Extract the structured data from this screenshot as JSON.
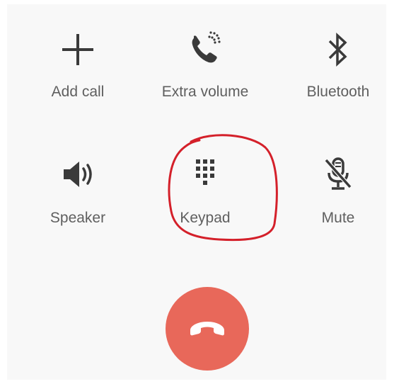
{
  "call_controls": {
    "row1": {
      "add_call": {
        "label": "Add call",
        "icon": "plus-icon"
      },
      "extra_volume": {
        "label": "Extra volume",
        "icon": "phone-volume-icon"
      },
      "bluetooth": {
        "label": "Bluetooth",
        "icon": "bluetooth-icon"
      }
    },
    "row2": {
      "speaker": {
        "label": "Speaker",
        "icon": "speaker-icon"
      },
      "keypad": {
        "label": "Keypad",
        "icon": "dialpad-icon"
      },
      "mute": {
        "label": "Mute",
        "icon": "mic-off-icon"
      }
    }
  },
  "end_call": {
    "icon": "end-call-icon",
    "color": "#e8685a"
  },
  "annotation": {
    "color": "#d4202a",
    "target": "Keypad"
  },
  "colors": {
    "icon": "#3a3a3a",
    "label": "#5f5f5f",
    "background": "#f8f8f8"
  }
}
